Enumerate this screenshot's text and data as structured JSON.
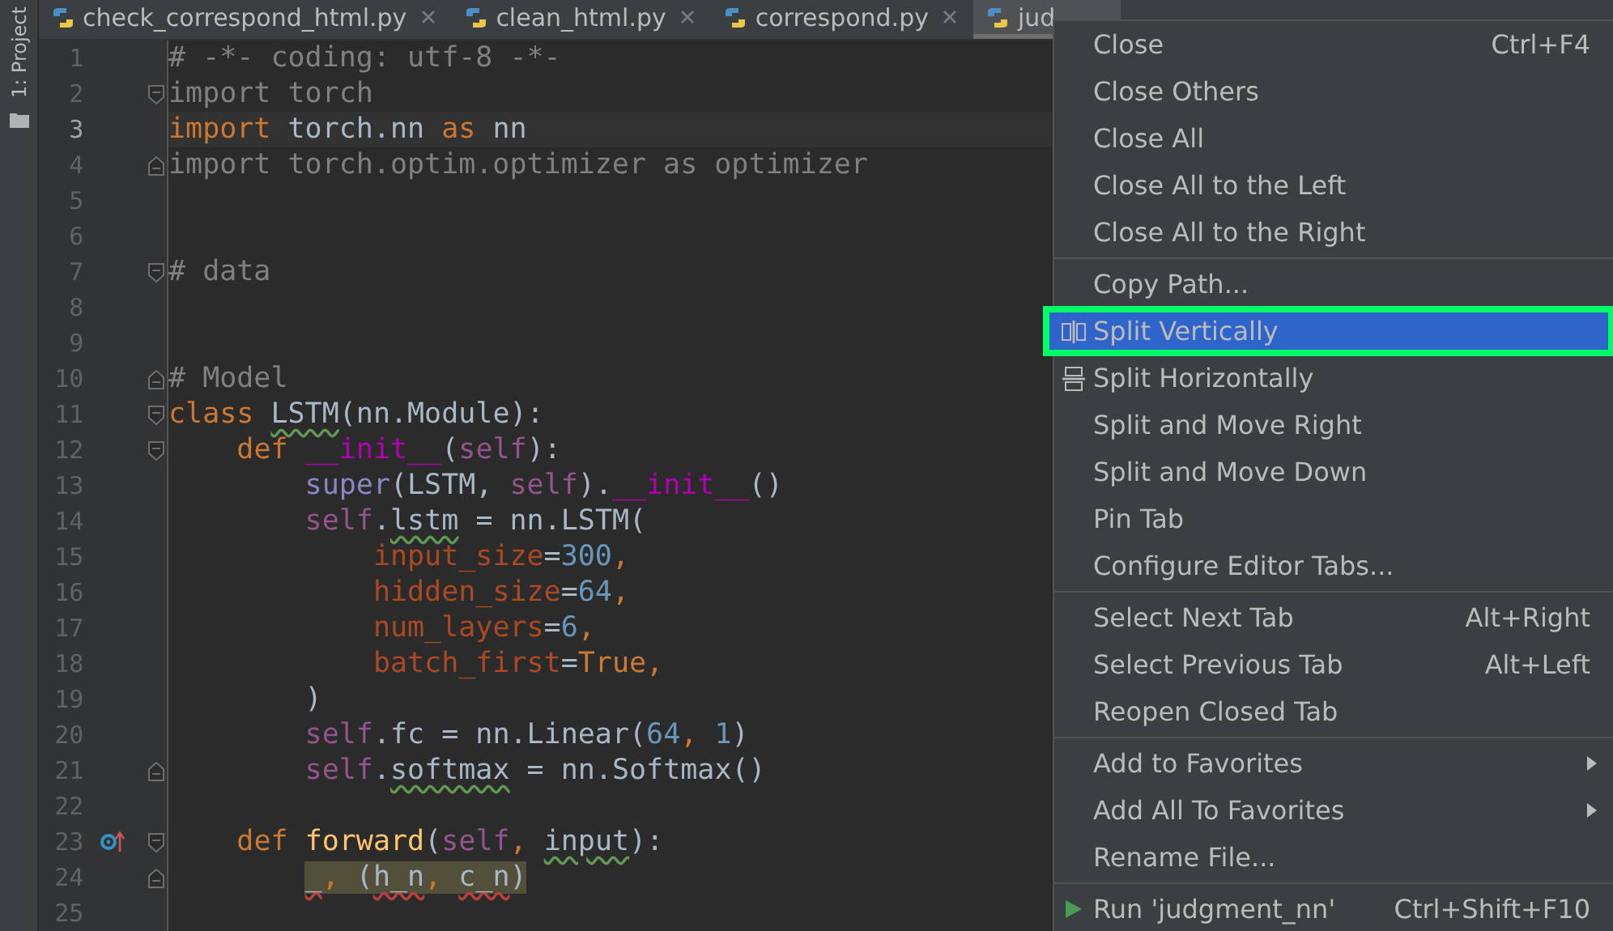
{
  "side_panel": {
    "label": "1: Project"
  },
  "tabs": [
    {
      "label": "check_correspond_html.py",
      "selected": false,
      "closable": true
    },
    {
      "label": "clean_html.py",
      "selected": false,
      "closable": true
    },
    {
      "label": "correspond.py",
      "selected": false,
      "closable": true
    },
    {
      "label": "jud",
      "selected": true,
      "closable": false
    }
  ],
  "editor": {
    "lines": [
      {
        "number": "1",
        "kind": "plain",
        "current": false,
        "tokens": [
          {
            "text": "# -*- coding: utf-8 -*-",
            "kind": "comment"
          }
        ]
      },
      {
        "number": "2",
        "kind": "fold-start",
        "current": false,
        "tokens": [
          {
            "text": "import torch",
            "kind": "dim"
          }
        ]
      },
      {
        "number": "3",
        "kind": "plain",
        "current": true,
        "tokens": [
          {
            "text": "import",
            "kind": "kw"
          },
          {
            "text": " torch.nn ",
            "kind": "plain"
          },
          {
            "text": "as",
            "kind": "kw"
          },
          {
            "text": " nn",
            "kind": "plain"
          }
        ]
      },
      {
        "number": "4",
        "kind": "fold-end",
        "current": false,
        "tokens": [
          {
            "text": "import torch.optim.optimizer as optimizer",
            "kind": "dim"
          }
        ]
      },
      {
        "number": "5",
        "kind": "plain",
        "current": false
      },
      {
        "number": "6",
        "kind": "plain",
        "current": false
      },
      {
        "number": "7",
        "kind": "fold-start",
        "current": false,
        "tokens": [
          {
            "text": "# data",
            "kind": "comment"
          }
        ]
      },
      {
        "number": "8",
        "kind": "plain",
        "current": false
      },
      {
        "number": "9",
        "kind": "plain",
        "current": false
      },
      {
        "number": "10",
        "kind": "fold-end",
        "current": false,
        "tokens": [
          {
            "text": "# Model",
            "kind": "comment"
          }
        ]
      },
      {
        "number": "11",
        "kind": "fold-start",
        "current": false,
        "tokens": [
          {
            "text": "class ",
            "kind": "kw"
          },
          {
            "text": "LSTM",
            "kind": "plain",
            "typo": true
          },
          {
            "text": "(nn.Module):",
            "kind": "plain"
          }
        ]
      },
      {
        "number": "12",
        "kind": "fold-start",
        "current": false,
        "tokens": [
          {
            "text": "    def ",
            "kind": "kw"
          },
          {
            "text": "__init__",
            "kind": "magic"
          },
          {
            "text": "(",
            "kind": "plain"
          },
          {
            "text": "self",
            "kind": "self"
          },
          {
            "text": "):",
            "kind": "plain"
          }
        ]
      },
      {
        "number": "13",
        "kind": "plain",
        "current": false,
        "tokens": [
          {
            "text": "        super",
            "kind": "builtin"
          },
          {
            "text": "(LSTM, ",
            "kind": "plain"
          },
          {
            "text": "self",
            "kind": "self"
          },
          {
            "text": ").",
            "kind": "plain"
          },
          {
            "text": "__init__",
            "kind": "magic"
          },
          {
            "text": "()",
            "kind": "plain"
          }
        ]
      },
      {
        "number": "14",
        "kind": "plain",
        "current": false,
        "tokens": [
          {
            "text": "        self",
            "kind": "self"
          },
          {
            "text": ".",
            "kind": "plain"
          },
          {
            "text": "lstm",
            "kind": "plain",
            "typo": true
          },
          {
            "text": " = nn.LSTM(",
            "kind": "plain"
          }
        ]
      },
      {
        "number": "15",
        "kind": "plain",
        "current": false,
        "tokens": [
          {
            "text": "            input_size",
            "kind": "param"
          },
          {
            "text": "=",
            "kind": "plain"
          },
          {
            "text": "300",
            "kind": "num"
          },
          {
            "text": ",",
            "kind": "kw"
          }
        ]
      },
      {
        "number": "16",
        "kind": "plain",
        "current": false,
        "tokens": [
          {
            "text": "            hidden_size",
            "kind": "param"
          },
          {
            "text": "=",
            "kind": "plain"
          },
          {
            "text": "64",
            "kind": "num"
          },
          {
            "text": ",",
            "kind": "kw"
          }
        ]
      },
      {
        "number": "17",
        "kind": "plain",
        "current": false,
        "tokens": [
          {
            "text": "            num_layers",
            "kind": "param"
          },
          {
            "text": "=",
            "kind": "plain"
          },
          {
            "text": "6",
            "kind": "num"
          },
          {
            "text": ",",
            "kind": "kw"
          }
        ]
      },
      {
        "number": "18",
        "kind": "plain",
        "current": false,
        "tokens": [
          {
            "text": "            batch_first",
            "kind": "param"
          },
          {
            "text": "=",
            "kind": "plain"
          },
          {
            "text": "True",
            "kind": "kw"
          },
          {
            "text": ",",
            "kind": "kw"
          }
        ]
      },
      {
        "number": "19",
        "kind": "plain",
        "current": false,
        "tokens": [
          {
            "text": "        )",
            "kind": "plain"
          }
        ]
      },
      {
        "number": "20",
        "kind": "plain",
        "current": false,
        "tokens": [
          {
            "text": "        self",
            "kind": "self"
          },
          {
            "text": ".fc = nn.Linear(",
            "kind": "plain"
          },
          {
            "text": "64",
            "kind": "num"
          },
          {
            "text": ", ",
            "kind": "kw"
          },
          {
            "text": "1",
            "kind": "num"
          },
          {
            "text": ")",
            "kind": "plain"
          }
        ]
      },
      {
        "number": "21",
        "kind": "fold-end",
        "current": false,
        "tokens": [
          {
            "text": "        self",
            "kind": "self"
          },
          {
            "text": ".",
            "kind": "plain"
          },
          {
            "text": "softmax",
            "kind": "plain",
            "typo": true
          },
          {
            "text": " = nn.Softmax()",
            "kind": "plain"
          }
        ]
      },
      {
        "number": "22",
        "kind": "plain",
        "current": false
      },
      {
        "number": "23",
        "kind": "fold-start",
        "current": false,
        "marker": true,
        "tokens": [
          {
            "text": "    def ",
            "kind": "kw"
          },
          {
            "text": "forward",
            "kind": "func"
          },
          {
            "text": "(",
            "kind": "plain"
          },
          {
            "text": "self",
            "kind": "self"
          },
          {
            "text": ", ",
            "kind": "kw"
          },
          {
            "text": "input",
            "kind": "plain",
            "typo": true
          },
          {
            "text": "):",
            "kind": "plain"
          }
        ]
      },
      {
        "number": "24",
        "kind": "fold-end",
        "current": false,
        "marked": true,
        "tokens": [
          {
            "text": "        _",
            "kind": "plain",
            "error": true
          },
          {
            "text": ", ",
            "kind": "kw"
          },
          {
            "text": "(",
            "kind": "plain"
          },
          {
            "text": "h_n",
            "kind": "plain",
            "error": true
          },
          {
            "text": ", ",
            "kind": "kw"
          },
          {
            "text": "c_n",
            "kind": "plain",
            "error": true
          },
          {
            "text": ")",
            "kind": "plain"
          }
        ]
      },
      {
        "number": "25",
        "kind": "plain",
        "current": false
      }
    ]
  },
  "context_menu": {
    "items": [
      {
        "kind": "item",
        "label": "Close",
        "shortcut": "Ctrl+F4",
        "selected": false
      },
      {
        "kind": "item",
        "label": "Close Others",
        "selected": false
      },
      {
        "kind": "item",
        "label": "Close All",
        "selected": false
      },
      {
        "kind": "item",
        "label": "Close All to the Left",
        "selected": false
      },
      {
        "kind": "item",
        "label": "Close All to the Right",
        "selected": false
      },
      {
        "kind": "separator"
      },
      {
        "kind": "item",
        "label": "Copy Path...",
        "selected": false
      },
      {
        "kind": "vsplit",
        "label": "Split Vertically",
        "selected": true
      },
      {
        "kind": "hsplit",
        "label": "Split Horizontally",
        "selected": false
      },
      {
        "kind": "item",
        "label": "Split and Move Right",
        "selected": false
      },
      {
        "kind": "item",
        "label": "Split and Move Down",
        "selected": false
      },
      {
        "kind": "item",
        "label": "Pin Tab",
        "selected": false
      },
      {
        "kind": "item",
        "label": "Configure Editor Tabs...",
        "selected": false
      },
      {
        "kind": "separator"
      },
      {
        "kind": "item",
        "label": "Select Next Tab",
        "shortcut": "Alt+Right",
        "selected": false
      },
      {
        "kind": "item",
        "label": "Select Previous Tab",
        "shortcut": "Alt+Left",
        "selected": false
      },
      {
        "kind": "item",
        "label": "Reopen Closed Tab",
        "selected": false
      },
      {
        "kind": "separator"
      },
      {
        "kind": "item",
        "label": "Add to Favorites",
        "submenu": true,
        "selected": false
      },
      {
        "kind": "item",
        "label": "Add All To Favorites",
        "submenu": true,
        "selected": false
      },
      {
        "kind": "item",
        "label": "Rename File...",
        "selected": false
      },
      {
        "kind": "separator"
      },
      {
        "kind": "run",
        "label": "Run 'judgment_nn'",
        "shortcut": "Ctrl+Shift+F10",
        "selected": false
      }
    ]
  }
}
